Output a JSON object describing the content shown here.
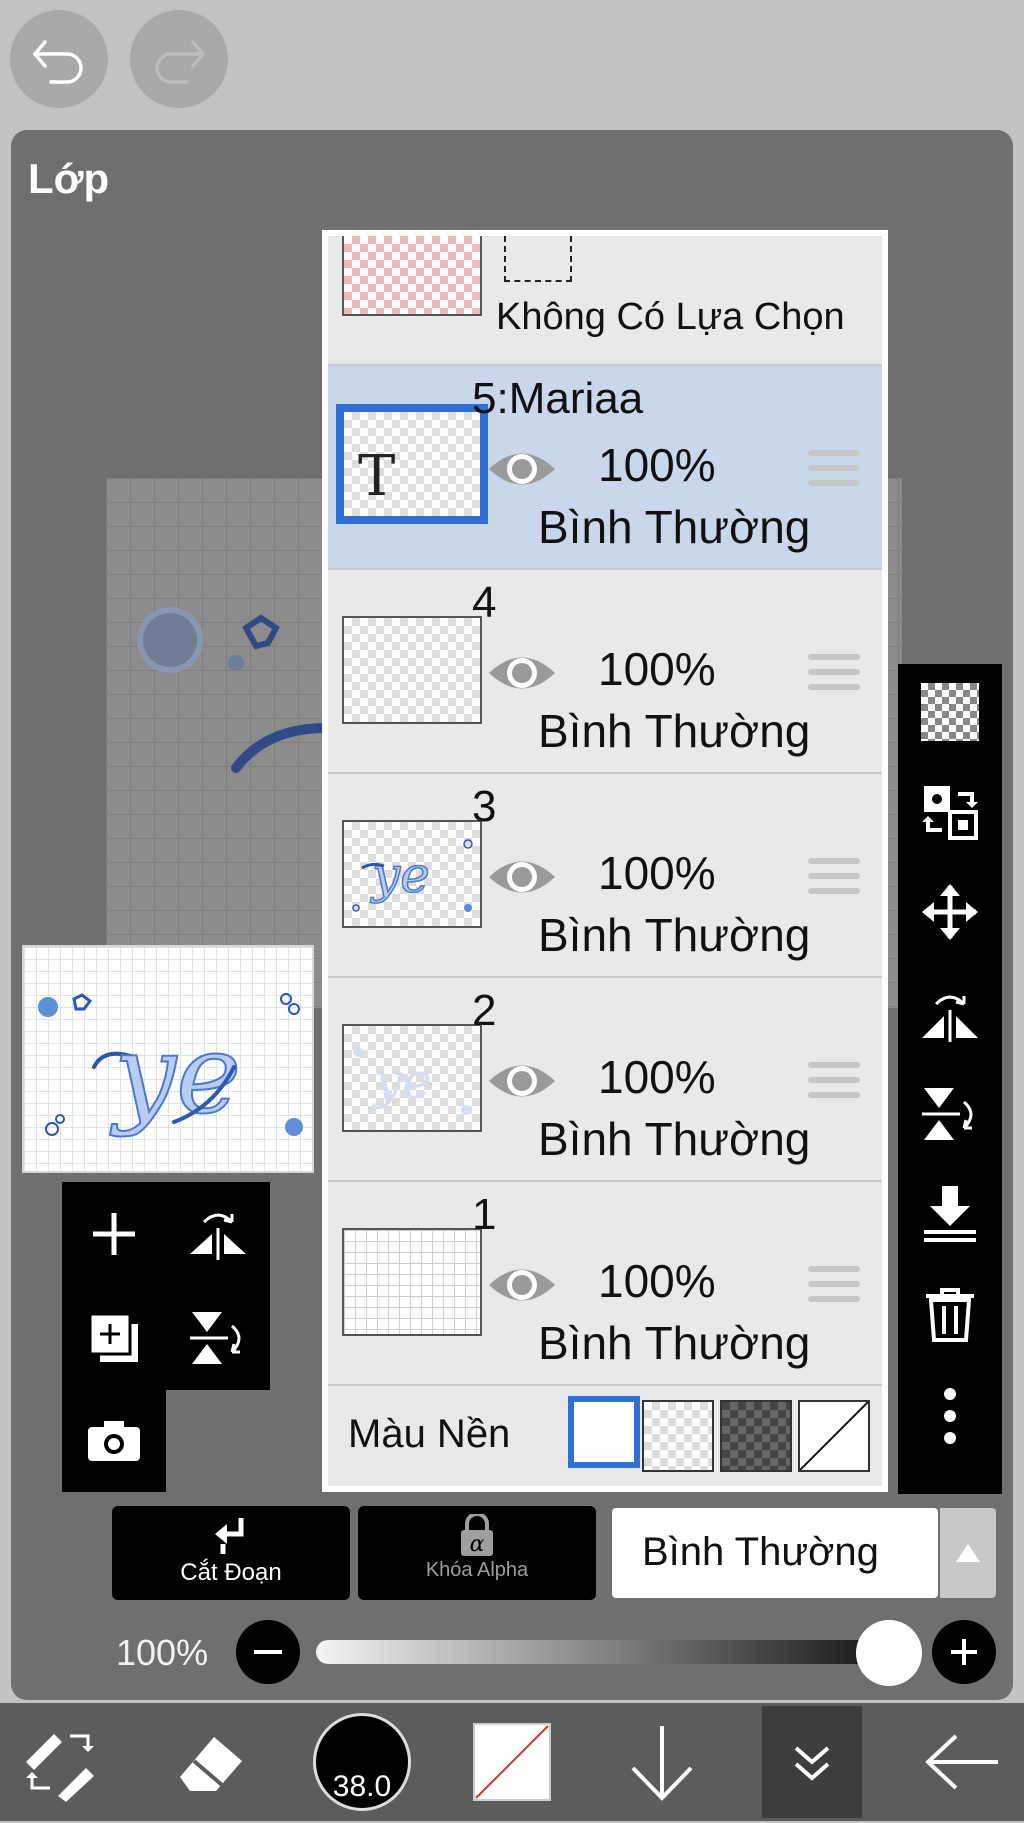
{
  "panel": {
    "title": "Lớp"
  },
  "selection_row": {
    "label": "Không Có Lựa Chọn"
  },
  "layers": [
    {
      "name": "5:Mariaa",
      "opacity": "100%",
      "mode": "Bình Thường",
      "selected": true,
      "thumb": "text"
    },
    {
      "name": "4",
      "opacity": "100%",
      "mode": "Bình Thường",
      "selected": false,
      "thumb": "empty"
    },
    {
      "name": "3",
      "opacity": "100%",
      "mode": "Bình Thường",
      "selected": false,
      "thumb": "art"
    },
    {
      "name": "2",
      "opacity": "100%",
      "mode": "Bình Thường",
      "selected": false,
      "thumb": "light"
    },
    {
      "name": "1",
      "opacity": "100%",
      "mode": "Bình Thường",
      "selected": false,
      "thumb": "grid"
    }
  ],
  "background": {
    "label": "Màu Nền"
  },
  "bottom": {
    "clip_label": "Cắt Đoạn",
    "alpha_label": "Khóa Alpha",
    "blend_mode": "Bình Thường",
    "opacity_label": "100%",
    "opacity_value": 1.0,
    "brush_size": "38.0"
  },
  "colors": {
    "accent": "#2e6fd6",
    "selected_row": "#cad7ea"
  }
}
